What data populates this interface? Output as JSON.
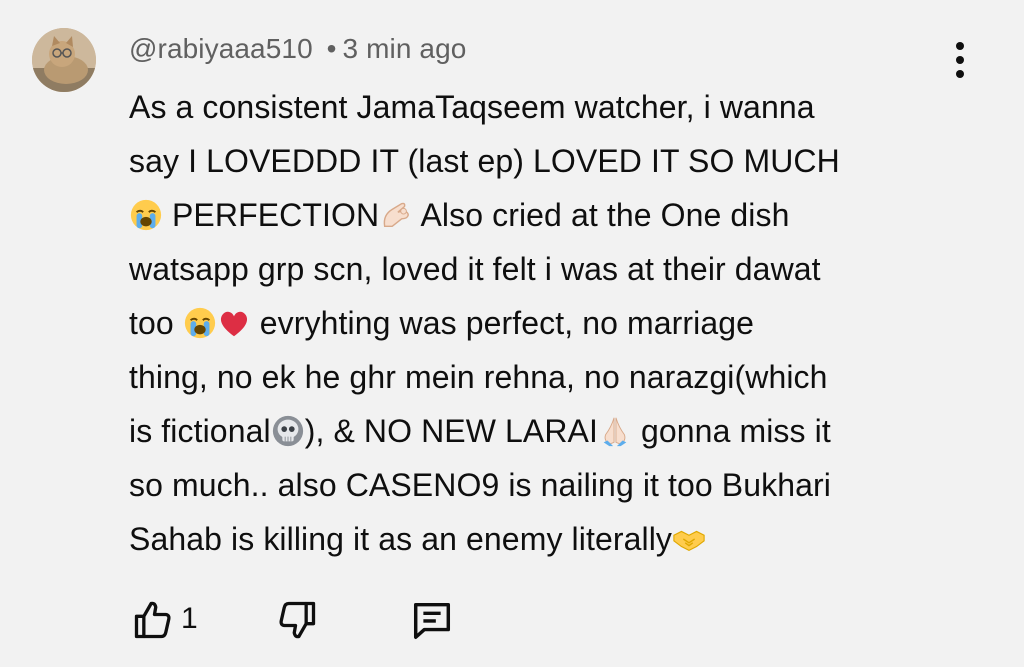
{
  "comment": {
    "username": "@rabiyaaa510",
    "separator": "•",
    "timestamp": "3 min ago",
    "avatar_icon": "cat-avatar",
    "menu_icon": "more-vertical-icon",
    "text_segments": {
      "l1": "As a consistent JamaTaqseem watcher, i wanna",
      "l2": "say I LOVEDDD IT (last ep) LOVED IT SO MUCH",
      "l3a": " PERFECTION",
      "l3b": " Also cried at the One dish",
      "l4": "watsapp grp scn, loved it felt i was at their dawat",
      "l5a": "too ",
      "l5b": " evryhting was perfect, no marriage",
      "l6": "thing, no ek he ghr mein rehna, no narazgi(which",
      "l7a": "is fictional",
      "l7b": "), &  NO NEW LARAI",
      "l7c": " gonna miss it",
      "l8": "so much.. also CASENO9 is nailing it too Bukhari",
      "l9": "Sahab is killing it as an enemy literally"
    },
    "emojis": [
      "loudly-crying-face",
      "pinching-hand",
      "loudly-crying-face",
      "red-heart",
      "skull",
      "folded-hands",
      "handshake"
    ]
  },
  "actions": {
    "like_icon": "thumbs-up-icon",
    "like_count": "1",
    "dislike_icon": "thumbs-down-icon",
    "reply_icon": "comment-reply-icon"
  },
  "colors": {
    "background": "#f2f2f2",
    "text": "#0f0f0f",
    "secondary_text": "#606060"
  }
}
